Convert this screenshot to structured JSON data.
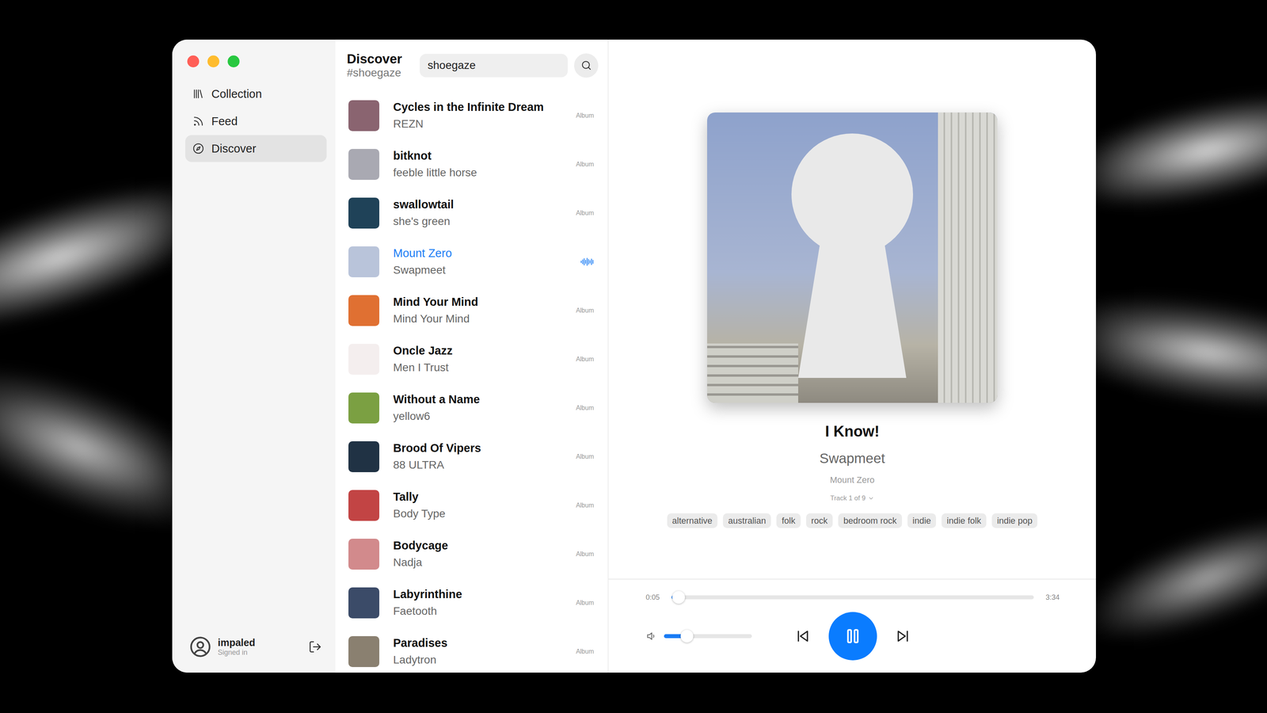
{
  "sidebar": {
    "items": [
      {
        "label": "Collection",
        "selected": false
      },
      {
        "label": "Feed",
        "selected": false
      },
      {
        "label": "Discover",
        "selected": true
      }
    ]
  },
  "user": {
    "name": "impaled",
    "status": "Signed in"
  },
  "header": {
    "title": "Discover",
    "subtitle": "#shoegaze"
  },
  "search": {
    "value": "shoegaze"
  },
  "results": [
    {
      "title": "Cycles in the Infinite Dream",
      "artist": "REZN",
      "badge": "Album",
      "kind": "album",
      "selected": false,
      "color": "#8a6470"
    },
    {
      "title": "bitknot",
      "artist": "feeble little horse",
      "badge": "Album",
      "kind": "album",
      "selected": false,
      "color": "#a9a9b2"
    },
    {
      "title": "swallowtail",
      "artist": "she's green",
      "badge": "Album",
      "kind": "album",
      "selected": false,
      "color": "#1f4258"
    },
    {
      "title": "Mount Zero",
      "artist": "Swapmeet",
      "kind": "playing",
      "selected": true,
      "color": "#b9c4da"
    },
    {
      "title": "Mind Your Mind",
      "artist": "Mind Your Mind",
      "badge": "Album",
      "kind": "album",
      "selected": false,
      "color": "#e07032"
    },
    {
      "title": "Oncle Jazz",
      "artist": "Men I Trust",
      "badge": "Album",
      "kind": "album",
      "selected": false,
      "color": "#f4eeee"
    },
    {
      "title": "Without a Name",
      "artist": "yellow6",
      "badge": "Album",
      "kind": "album",
      "selected": false,
      "color": "#7ba042"
    },
    {
      "title": "Brood Of Vipers",
      "artist": "88 ULTRA",
      "badge": "Album",
      "kind": "album",
      "selected": false,
      "color": "#203244"
    },
    {
      "title": "Tally",
      "artist": "Body Type",
      "badge": "Album",
      "kind": "album",
      "selected": false,
      "color": "#c24444"
    },
    {
      "title": "Bodycage",
      "artist": "Nadja",
      "badge": "Album",
      "kind": "album",
      "selected": false,
      "color": "#d28a8c"
    },
    {
      "title": "Labyrinthine",
      "artist": "Faetooth",
      "badge": "Album",
      "kind": "album",
      "selected": false,
      "color": "#3b4b68"
    },
    {
      "title": "Paradises",
      "artist": "Ladytron",
      "badge": "Album",
      "kind": "album",
      "selected": false,
      "color": "#8a8070"
    }
  ],
  "now_playing": {
    "title": "I Know!",
    "artist": "Swapmeet",
    "album": "Mount Zero",
    "track": "Track 1 of 9",
    "tags": [
      "alternative",
      "australian",
      "folk",
      "rock",
      "bedroom rock",
      "indie",
      "indie folk",
      "indie pop"
    ]
  },
  "player": {
    "elapsed": "0:05",
    "duration": "3:34",
    "progress": {
      "level": 0.02
    },
    "volume": {
      "level": 0.26
    },
    "playing": true
  }
}
